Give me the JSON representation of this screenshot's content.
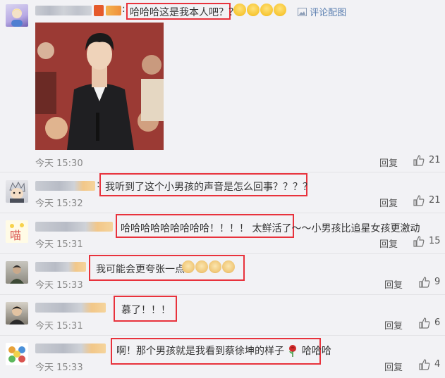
{
  "toolbar": {
    "review_image_label": "评论配图"
  },
  "comments": [
    {
      "text": "哈哈哈这是我本人吧？？",
      "time": "今天 15:30",
      "reply_label": "回复",
      "likes": "21",
      "emoji": [
        "laugh-emoji",
        "laugh-emoji",
        "laugh-emoji",
        "laugh-emoji"
      ],
      "has_image": true
    },
    {
      "text": "我听到了这个小男孩的声音是怎么回事？？？？",
      "time": "今天 15:32",
      "reply_label": "回复",
      "likes": "21"
    },
    {
      "text": "哈哈哈哈哈哈哈哈哈！！！！ 太鲜活了～～小男孩比追星女孩更激动",
      "time": "今天 15:31",
      "reply_label": "回复",
      "likes": "15"
    },
    {
      "text": "我可能会更夸张一点",
      "time": "今天 15:33",
      "reply_label": "回复",
      "likes": "9",
      "emoji": [
        "doge-emoji",
        "doge-emoji",
        "doge-emoji",
        "doge-emoji"
      ]
    },
    {
      "text": "慕了！！！",
      "time": "今天 15:31",
      "reply_label": "回复",
      "likes": "6"
    },
    {
      "text_before": "啊！那个男孩就是我看到蔡徐坤的样子",
      "text_after": "哈哈哈",
      "time": "今天 15:33",
      "reply_label": "回复",
      "likes": "4",
      "emoji": [
        "rose-emoji"
      ]
    }
  ],
  "colors": {
    "highlight": "#e8323c",
    "background": "#f2f2f5",
    "meta_text": "#888888"
  }
}
